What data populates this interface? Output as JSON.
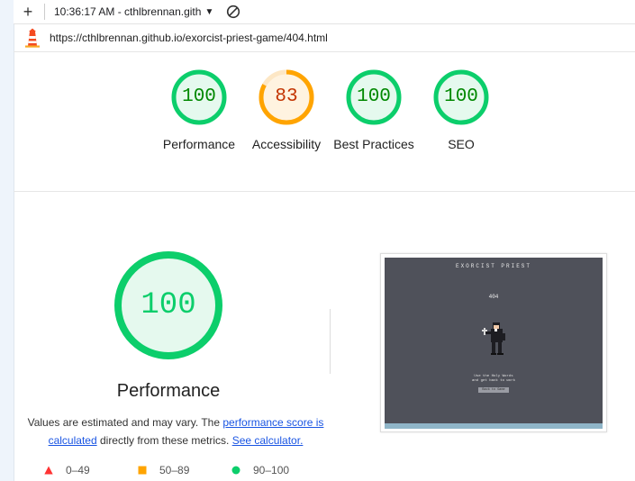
{
  "toolbar": {
    "report_selector": "10:36:17 AM - cthlbrennan.gith"
  },
  "url_bar": {
    "url": "https://cthlbrennan.github.io/exorcist-priest-game/404.html"
  },
  "gauges": [
    {
      "label": "Performance",
      "score": "100",
      "rating": "pass"
    },
    {
      "label": "Accessibility",
      "score": "83",
      "rating": "average"
    },
    {
      "label": "Best Practices",
      "score": "100",
      "rating": "pass"
    },
    {
      "label": "SEO",
      "score": "100",
      "rating": "pass"
    }
  ],
  "main": {
    "score": "100",
    "title": "Performance",
    "desc_prefix": "Values are estimated and may vary. The ",
    "desc_link1": "performance score is calculated",
    "desc_mid": " directly from these metrics. ",
    "desc_link2": "See calculator."
  },
  "legend": [
    {
      "range": "0–49",
      "color": "#ff3333"
    },
    {
      "range": "50–89",
      "color": "#ffa400"
    },
    {
      "range": "90–100",
      "color": "#0cce6b"
    }
  ],
  "screenshot": {
    "title": "EXORCIST PRIEST",
    "code": "404",
    "message_line1": "Use the Holy Words",
    "message_line2": "and get back to work",
    "button": "Back to Game"
  },
  "colors": {
    "pass": "#0cce6b",
    "average": "#ffa400",
    "fail": "#ff3333",
    "pass_bg": "#e5f9ee",
    "average_bg": "#fff3e0",
    "pass_text": "#008800",
    "average_text": "#c33300"
  }
}
